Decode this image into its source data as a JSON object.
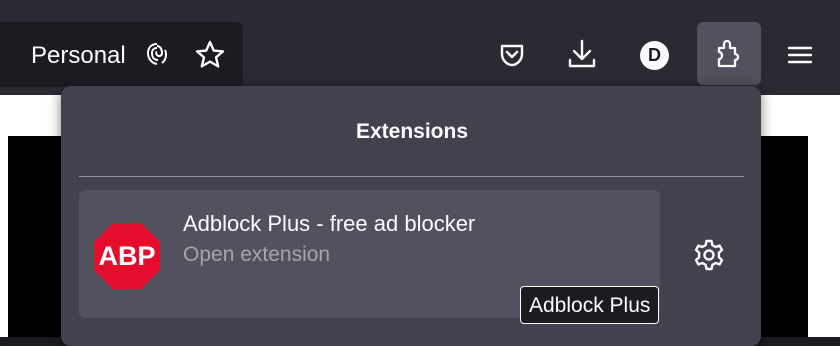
{
  "toolbar": {
    "container_label": "Personal",
    "avatar_letter": "D"
  },
  "icons": {
    "fingerprint": "fingerprint-icon",
    "bookmark": "star-icon",
    "pocket": "pocket-icon",
    "downloads": "download-icon",
    "extensions": "puzzle-icon",
    "menu": "hamburger-menu-icon",
    "settings": "gear-icon"
  },
  "panel": {
    "title": "Extensions",
    "extensions": [
      {
        "name": "Adblock Plus - free ad blocker",
        "subtitle": "Open extension",
        "logo_text": "ABP",
        "logo_color": "#e40d2d"
      }
    ]
  },
  "tooltip": {
    "text": "Adblock Plus"
  },
  "colors": {
    "toolbar_bg": "#2b2a33",
    "panel_bg": "#42414d",
    "item_bg": "#52525e",
    "text": "#fbfbfe"
  }
}
